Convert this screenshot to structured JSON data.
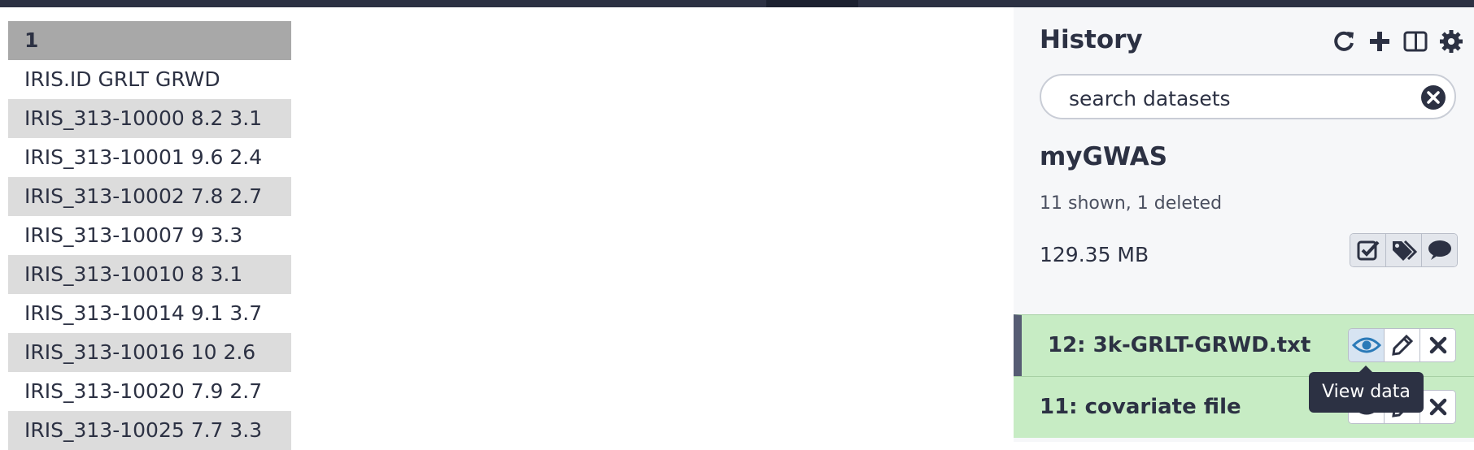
{
  "preview": {
    "header": "1",
    "rows": [
      "IRIS.ID GRLT GRWD",
      "IRIS_313-10000 8.2 3.1",
      "IRIS_313-10001 9.6 2.4",
      "IRIS_313-10002 7.8 2.7",
      "IRIS_313-10007 9 3.3",
      "IRIS_313-10010 8 3.1",
      "IRIS_313-10014 9.1 3.7",
      "IRIS_313-10016 10 2.6",
      "IRIS_313-10020 7.9 2.7",
      "IRIS_313-10025 7.7 3.3"
    ]
  },
  "history": {
    "title": "History",
    "icons": [
      "refresh-icon",
      "plus-icon",
      "columns-icon",
      "gear-icon"
    ],
    "search_placeholder": "search datasets",
    "name": "myGWAS",
    "counts": "11 shown, 1 deleted",
    "size": "129.35 MB",
    "datasets": [
      {
        "label": "12: 3k-GRLT-GRWD.txt"
      },
      {
        "label": "11: covariate file"
      }
    ],
    "tooltip": "View data"
  },
  "colors": {
    "topbar": "#2c3143",
    "dataset_ok": "#c7ecc4",
    "history_bg": "#f6f7f9",
    "table_stripe": "#dcdcdc",
    "table_header": "#a8a8a8"
  }
}
